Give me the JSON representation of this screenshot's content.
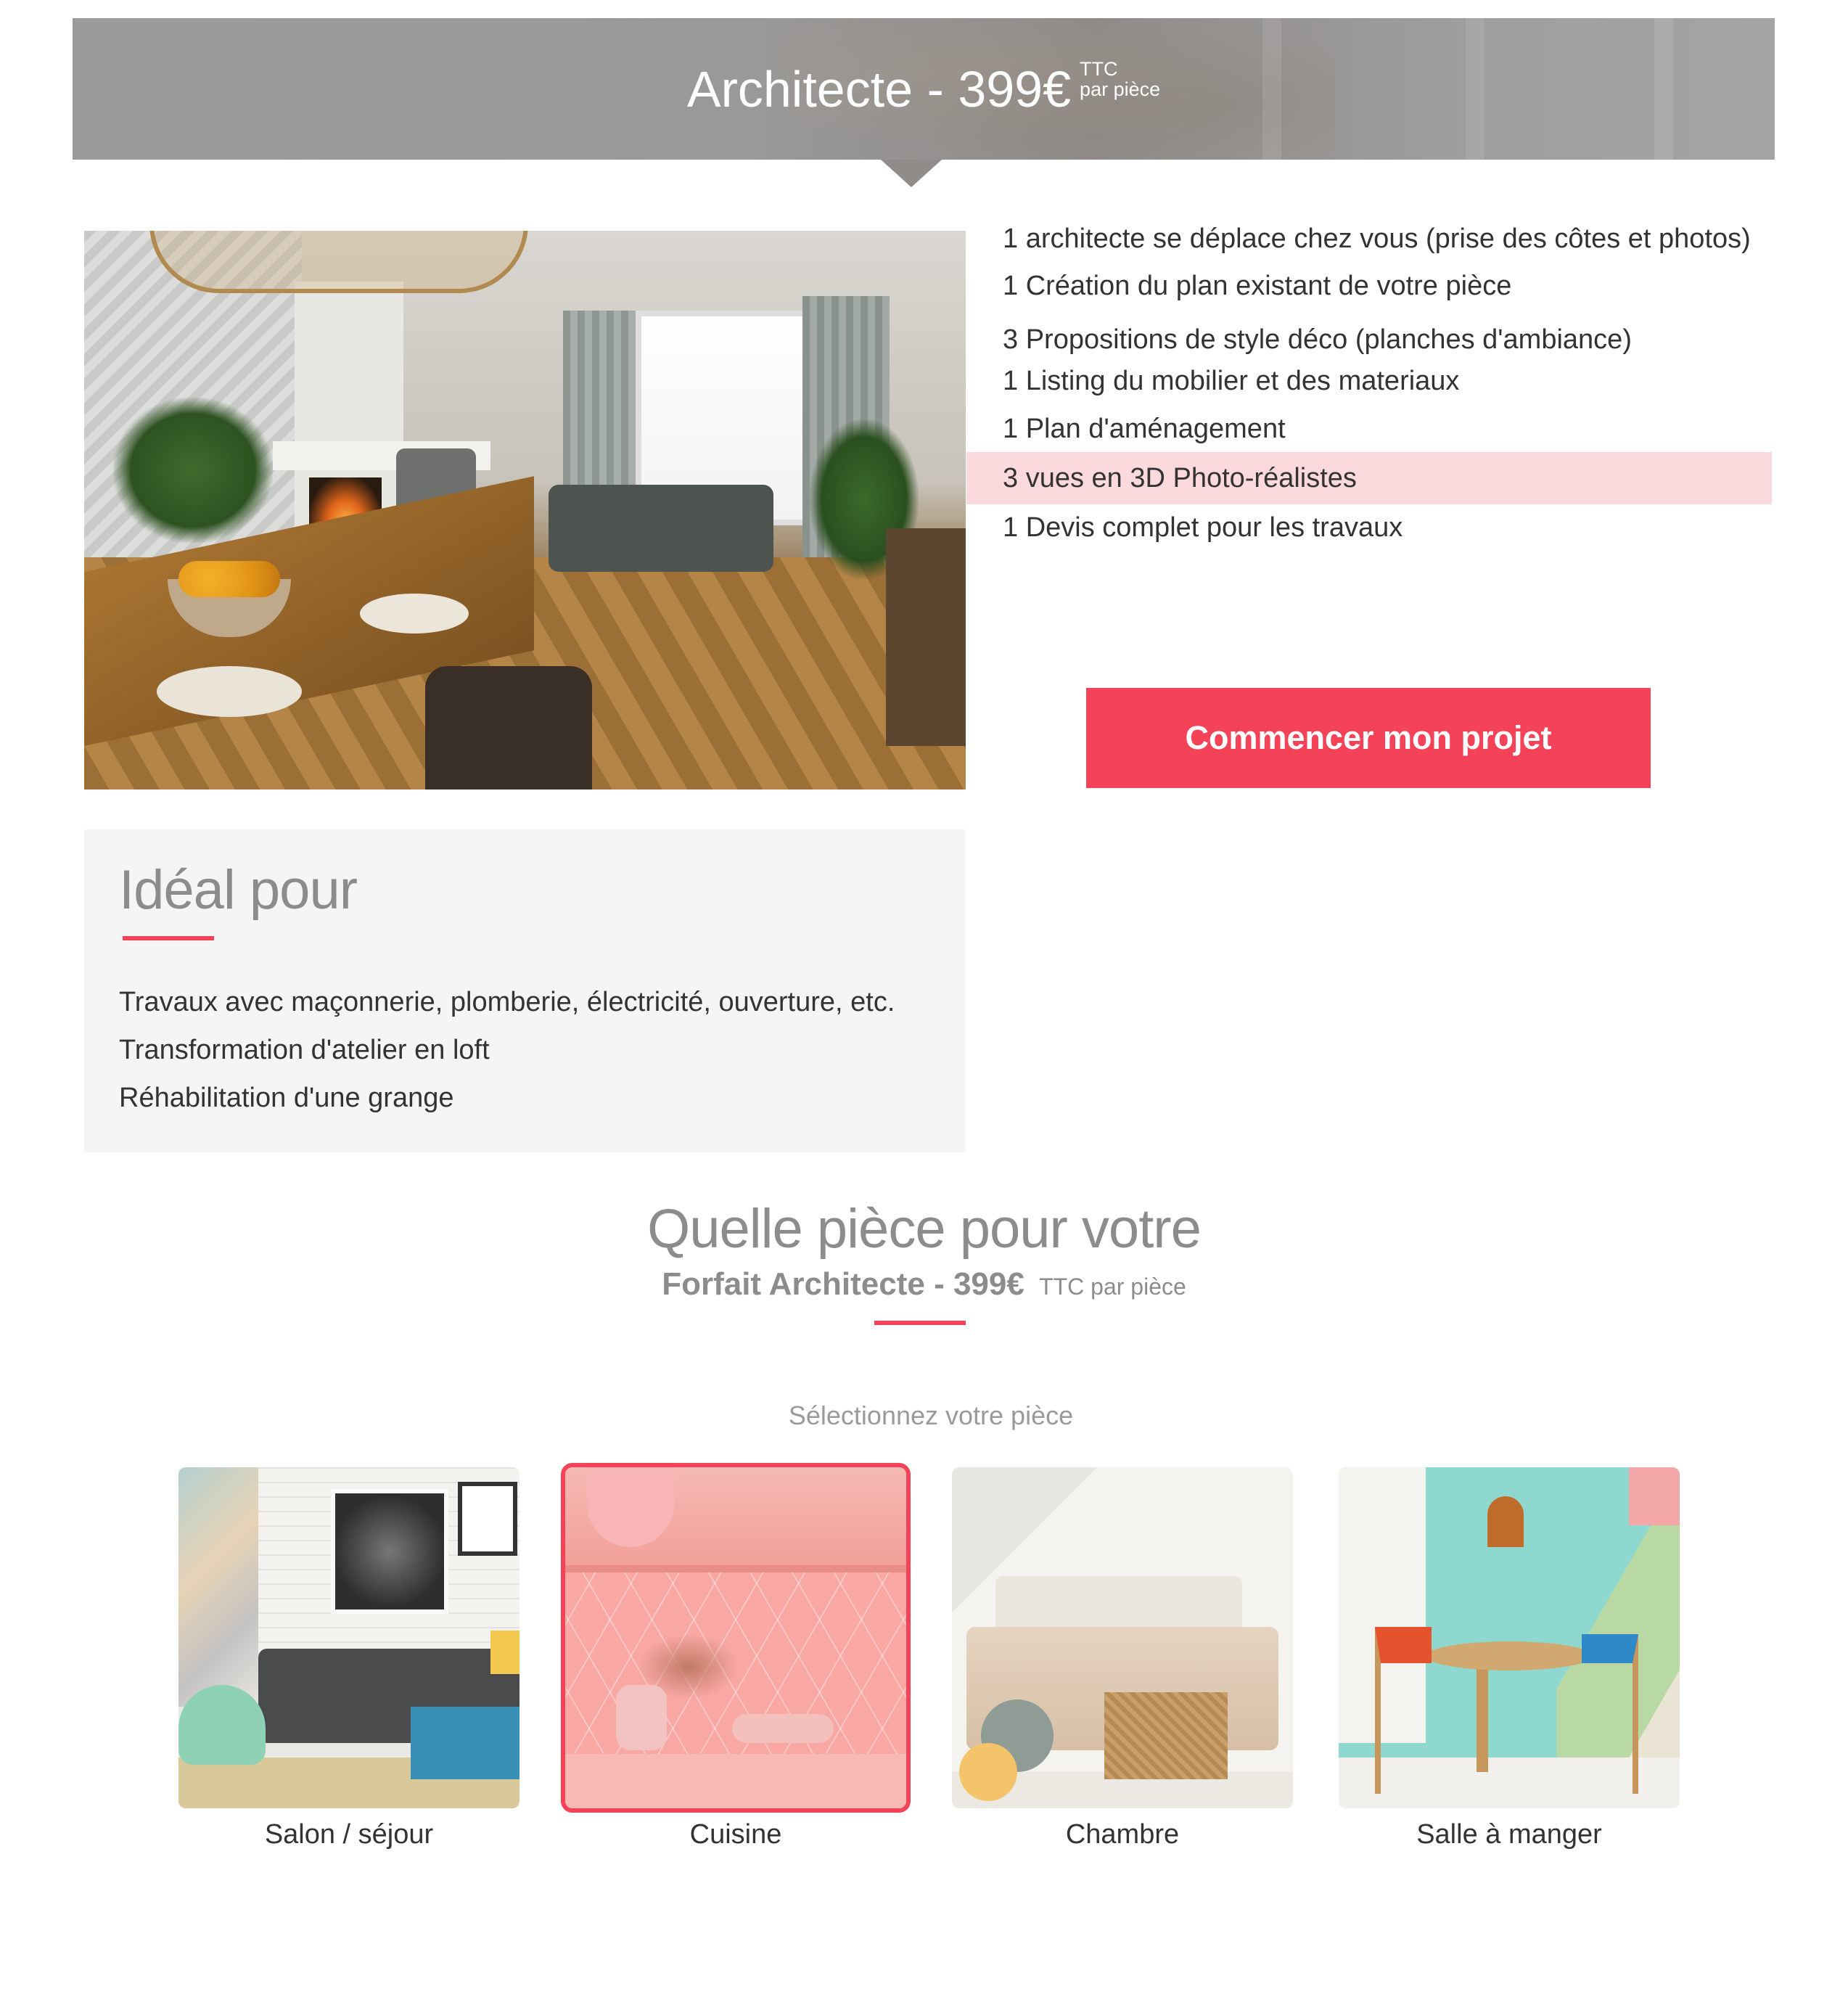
{
  "header": {
    "title": "Architecte - 399€",
    "sup_top": "TTC",
    "sup_bottom": "par pièce"
  },
  "features": [
    "1 architecte se déplace chez vous (prise des côtes et photos)",
    "1 Création du plan existant de votre pièce",
    "3 Propositions de style déco  (planches d'ambiance)",
    "1 Listing du mobilier et des materiaux",
    "1 Plan d'aménagement",
    "3 vues en 3D Photo-réalistes",
    "1 Devis complet pour les travaux"
  ],
  "cta_label": "Commencer mon projet",
  "ideal": {
    "title": "Idéal pour",
    "items": [
      "Travaux avec maçonnerie, plomberie, électricité, ouverture, etc.",
      "Transformation d'atelier en loft",
      "Réhabilitation d'une grange"
    ]
  },
  "room_section": {
    "title": "Quelle pièce pour votre",
    "subtitle_bold": "Forfait Architecte - 399€",
    "subtitle_small": "TTC par pièce",
    "hint": "Sélectionnez votre pièce",
    "rooms": [
      {
        "label": "Salon / séjour",
        "selected": false
      },
      {
        "label": "Cuisine",
        "selected": true
      },
      {
        "label": "Chambre",
        "selected": false
      },
      {
        "label": "Salle à manger",
        "selected": false
      }
    ]
  },
  "colors": {
    "accent": "#f44258",
    "highlight_row": "#fcd9dc",
    "banner_gray": "#9c9b9a",
    "ideal_bg": "#f5f5f5"
  }
}
